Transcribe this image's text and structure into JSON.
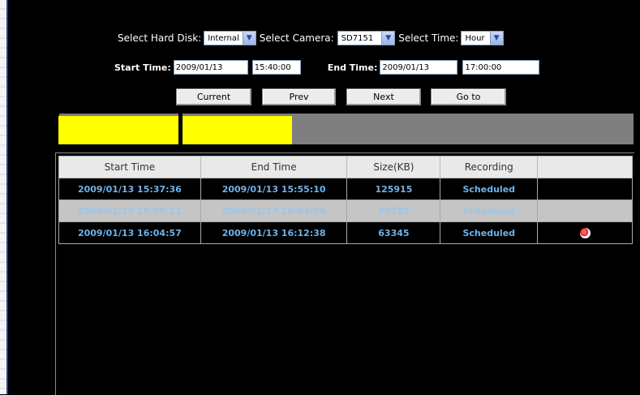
{
  "toolbar": {
    "hard_disk_label": "Select Hard Disk:",
    "hard_disk_value": "Internal",
    "camera_label": "Select Camera:",
    "camera_value": "SD7151",
    "time_label": "Select Time:",
    "time_value": "Hour",
    "start_time_label": "Start Time:",
    "start_date": "2009/01/13",
    "start_clock": "15:40:00",
    "end_time_label": "End Time:",
    "end_date": "2009/01/13",
    "end_clock": "17:00:00",
    "buttons": {
      "current": "Current",
      "prev": "Prev",
      "next": "Next",
      "goto": "Go to"
    }
  },
  "timeline": {
    "fill_color": "#ffff00",
    "track_color": "#7f7f7f"
  },
  "table": {
    "headers": [
      "Start Time",
      "End Time",
      "Size(KB)",
      "Recording",
      ""
    ],
    "rows": [
      [
        "2009/01/13 15:37:36",
        "2009/01/13 15:55:10",
        "125915",
        "Scheduled"
      ],
      [
        "2009/01/13 15:55:11",
        "2009/01/13 16:04:56",
        "70225",
        "Scheduled"
      ],
      [
        "2009/01/13 16:04:57",
        "2009/01/13 16:12:38",
        "63345",
        "Scheduled"
      ]
    ],
    "row3_icon": "record-disc-icon"
  },
  "colors": {
    "accent_text": "#6fb2ea",
    "background": "#000000"
  }
}
